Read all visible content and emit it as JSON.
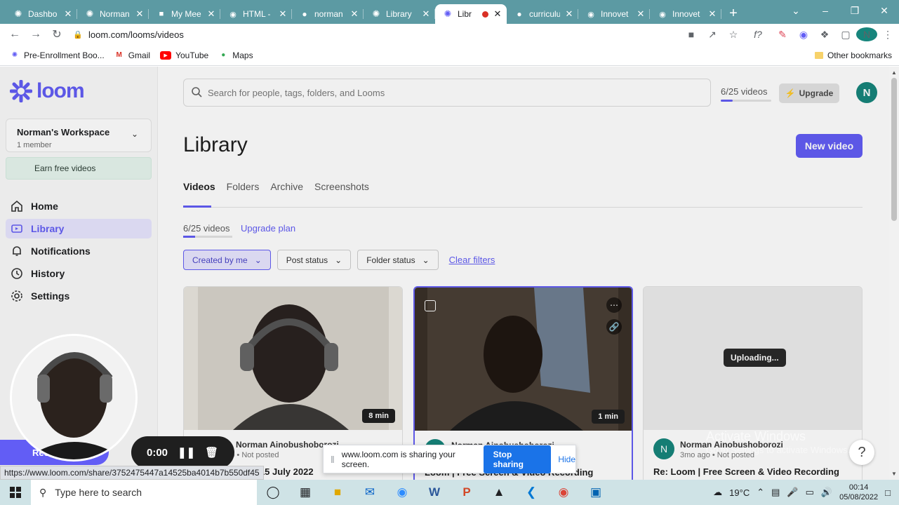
{
  "browser": {
    "tabs": [
      {
        "title": "Dashbo",
        "fav": "loom"
      },
      {
        "title": "Norman",
        "fav": "loom"
      },
      {
        "title": "My Mee",
        "fav": "video"
      },
      {
        "title": "HTML -",
        "fav": "globe"
      },
      {
        "title": "norman",
        "fav": "github"
      },
      {
        "title": "Library",
        "fav": "loom"
      },
      {
        "title": "Libr",
        "fav": "loom",
        "active": true
      },
      {
        "title": "curriculu",
        "fav": "github"
      },
      {
        "title": "Innovet",
        "fav": "globe"
      },
      {
        "title": "Innovet",
        "fav": "globe"
      }
    ],
    "url": "loom.com/looms/videos",
    "profile_initial": "N",
    "bookmarks": [
      {
        "label": "Pre-Enrollment Boo...",
        "icon": "loom"
      },
      {
        "label": "Gmail",
        "icon": "gmail"
      },
      {
        "label": "YouTube",
        "icon": "youtube"
      },
      {
        "label": "Maps",
        "icon": "maps"
      }
    ],
    "other_bookmarks": "Other bookmarks"
  },
  "sidebar": {
    "logo_text": "loom",
    "workspace": {
      "name": "Norman's Workspace",
      "members": "1 member"
    },
    "earn": "Earn free videos",
    "nav": [
      {
        "label": "Home",
        "icon": "home-icon"
      },
      {
        "label": "Library",
        "icon": "library-icon",
        "active": true
      },
      {
        "label": "Notifications",
        "icon": "bell-icon"
      },
      {
        "label": "History",
        "icon": "history-icon"
      },
      {
        "label": "Settings",
        "icon": "gear-icon"
      }
    ]
  },
  "header": {
    "search_placeholder": "Search for people, tags, folders, and Looms",
    "quota": "6/25 videos",
    "quota_fraction": 0.24,
    "upgrade": "Upgrade",
    "avatar": "N"
  },
  "library": {
    "title": "Library",
    "new_video": "New video",
    "tabs": [
      "Videos",
      "Folders",
      "Archive",
      "Screenshots"
    ],
    "count": "6/25 videos",
    "upgrade_plan": "Upgrade plan",
    "filters": [
      "Created by me",
      "Post status",
      "Folder status"
    ],
    "clear_filters": "Clear filters"
  },
  "cards": [
    {
      "duration": "8 min",
      "author": "Norman Ainobushoborozi",
      "sub": "ago • Not posted",
      "title": "age - 15 July 2022"
    },
    {
      "duration": "1 min",
      "author": "Norman Ainobushoborozi",
      "sub": "",
      "title": "Loom | Free Screen & Video Recording"
    },
    {
      "uploading": "Uploading...",
      "author": "Norman Ainobushoborozi",
      "sub": "3mo ago • Not posted",
      "title": "Re: Loom | Free Screen & Video Recording",
      "avatar": "N"
    }
  ],
  "recorder": {
    "pill": "Rec",
    "time": "0:00"
  },
  "share_bar": {
    "text": "www.loom.com is sharing your screen.",
    "stop": "Stop sharing",
    "hide": "Hide"
  },
  "status_url": "https://www.loom.com/share/3752475447a14525ba4014b7b550df45",
  "watermark": {
    "line1": "Activate Windows",
    "line2": "Go to Settings to activate Windows."
  },
  "taskbar": {
    "search": "Type here to search",
    "temperature": "19°C",
    "time": "00:14",
    "date": "05/08/2022"
  },
  "colors": {
    "accent": "#625df5",
    "tabbar": "#5c9aa3",
    "avatar": "#17857c"
  }
}
